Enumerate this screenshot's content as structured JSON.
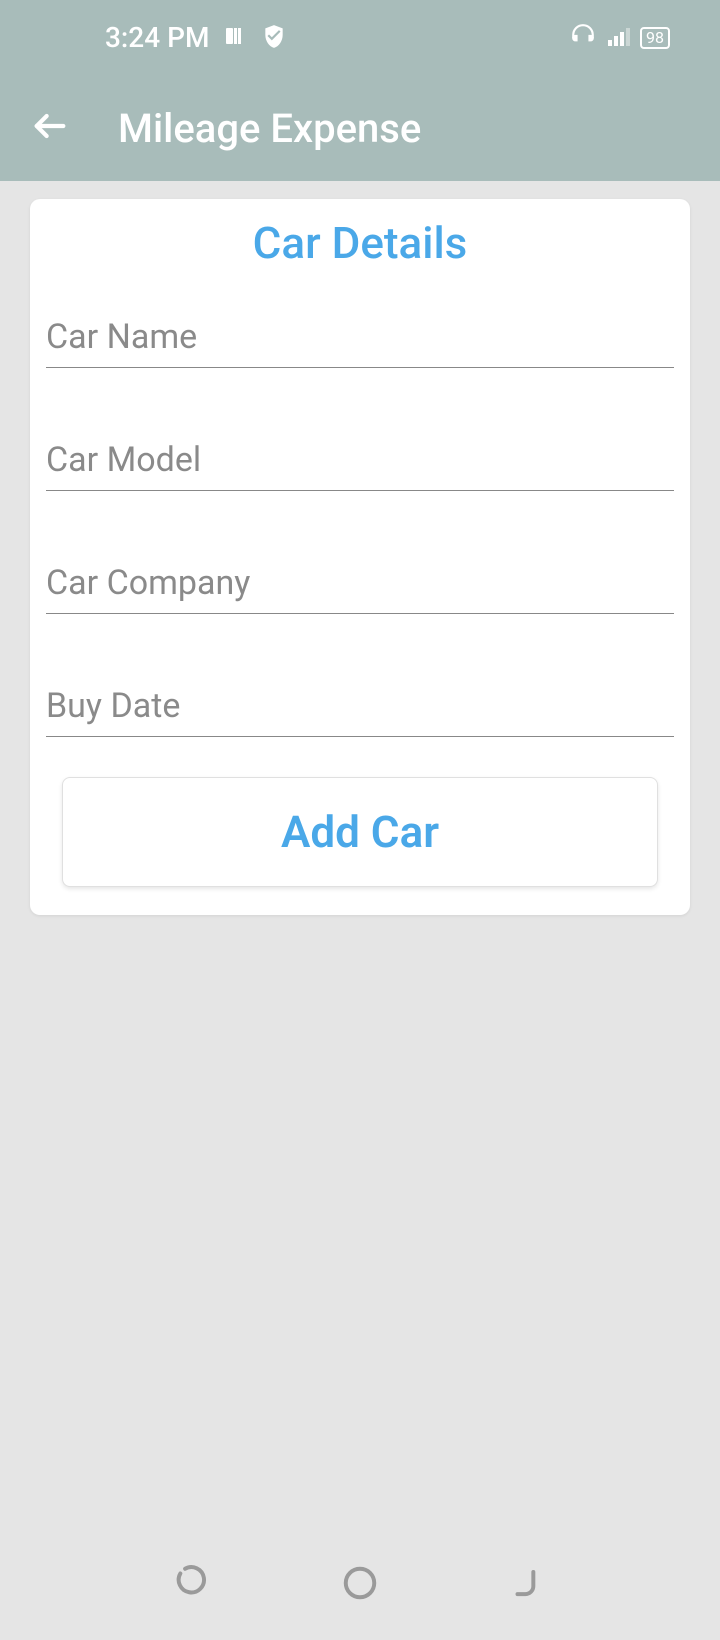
{
  "status": {
    "time": "3:24 PM",
    "battery": "98"
  },
  "appbar": {
    "title": "Mileage Expense"
  },
  "card": {
    "title": "Car Details",
    "fields": {
      "car_name": {
        "placeholder": "Car Name",
        "value": ""
      },
      "car_model": {
        "placeholder": "Car Model",
        "value": ""
      },
      "car_company": {
        "placeholder": "Car Company",
        "value": ""
      },
      "buy_date": {
        "placeholder": "Buy Date",
        "value": ""
      }
    },
    "button_label": "Add Car"
  }
}
